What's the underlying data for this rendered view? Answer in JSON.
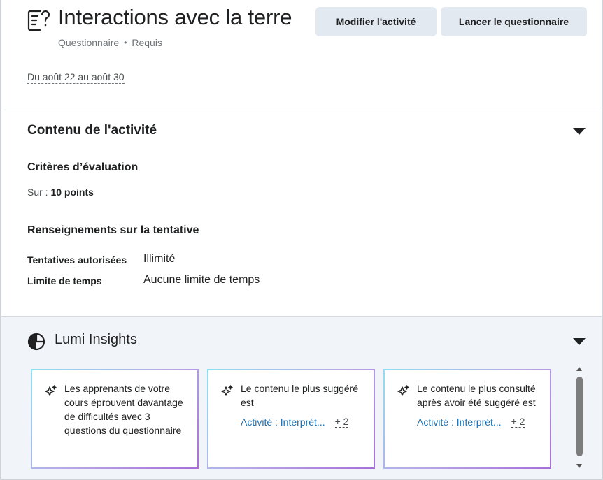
{
  "header": {
    "title": "Interactions avec la terre",
    "type": "Questionnaire",
    "separator": "•",
    "status": "Requis",
    "dates": "Du août 22 au août 30",
    "icon": "quiz-icon"
  },
  "toolbar": {
    "edit_label": "Modifier l'activité",
    "launch_label": "Lancer le questionnaire"
  },
  "content": {
    "title": "Contenu de l'activité",
    "criteria_title": "Critères d’évaluation",
    "out_of_label": "Sur :",
    "out_of_value": "10 points",
    "attempt_title": "Renseignements sur la tentative",
    "rows": [
      {
        "label": "Tentatives autorisées",
        "value": "Illimité"
      },
      {
        "label": "Limite de temps",
        "value": "Aucune limite de temps"
      }
    ]
  },
  "insights": {
    "title": "Lumi Insights",
    "icon": "pie-chart-icon",
    "cards": [
      {
        "text": "Les apprenants de votre cours éprouvent davantage de difficultés avec 3 questions du questionnaire",
        "link": "",
        "more": ""
      },
      {
        "text": "Le contenu le plus suggéré est",
        "link": "Activité : Interprét...",
        "more": "+ 2"
      },
      {
        "text": "Le contenu le plus consulté après avoir été suggéré est",
        "link": "Activité : Interprét...",
        "more": "+ 2"
      }
    ]
  },
  "colors": {
    "button_bg": "#e3e9f1",
    "link": "#1d6fae",
    "insights_bg": "#f1f4f9",
    "card_gradient_start": "#8ee0f2",
    "card_gradient_end": "#a66fd7"
  }
}
